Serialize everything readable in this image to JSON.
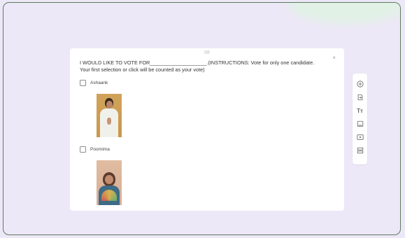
{
  "form": {
    "question": "I WOULD LIKE TO VOTE FOR____________________.(INSTRUCTIONS: Vote for only one candidate. Your first selection or click will be counted as your vote)",
    "close_glyph": "×",
    "options": [
      {
        "label": "Ashaank"
      },
      {
        "label": "Poornima"
      }
    ]
  },
  "toolbar": {
    "title_text_glyph": "Tт",
    "items": [
      {
        "icon": "add-circle-icon"
      },
      {
        "icon": "import-question-icon"
      },
      {
        "icon": "title-text-icon"
      },
      {
        "icon": "image-icon"
      },
      {
        "icon": "video-icon"
      },
      {
        "icon": "section-icon"
      }
    ]
  },
  "colors": {
    "background": "#ede8f7",
    "frame_border": "#5e7a60",
    "card": "#ffffff"
  }
}
